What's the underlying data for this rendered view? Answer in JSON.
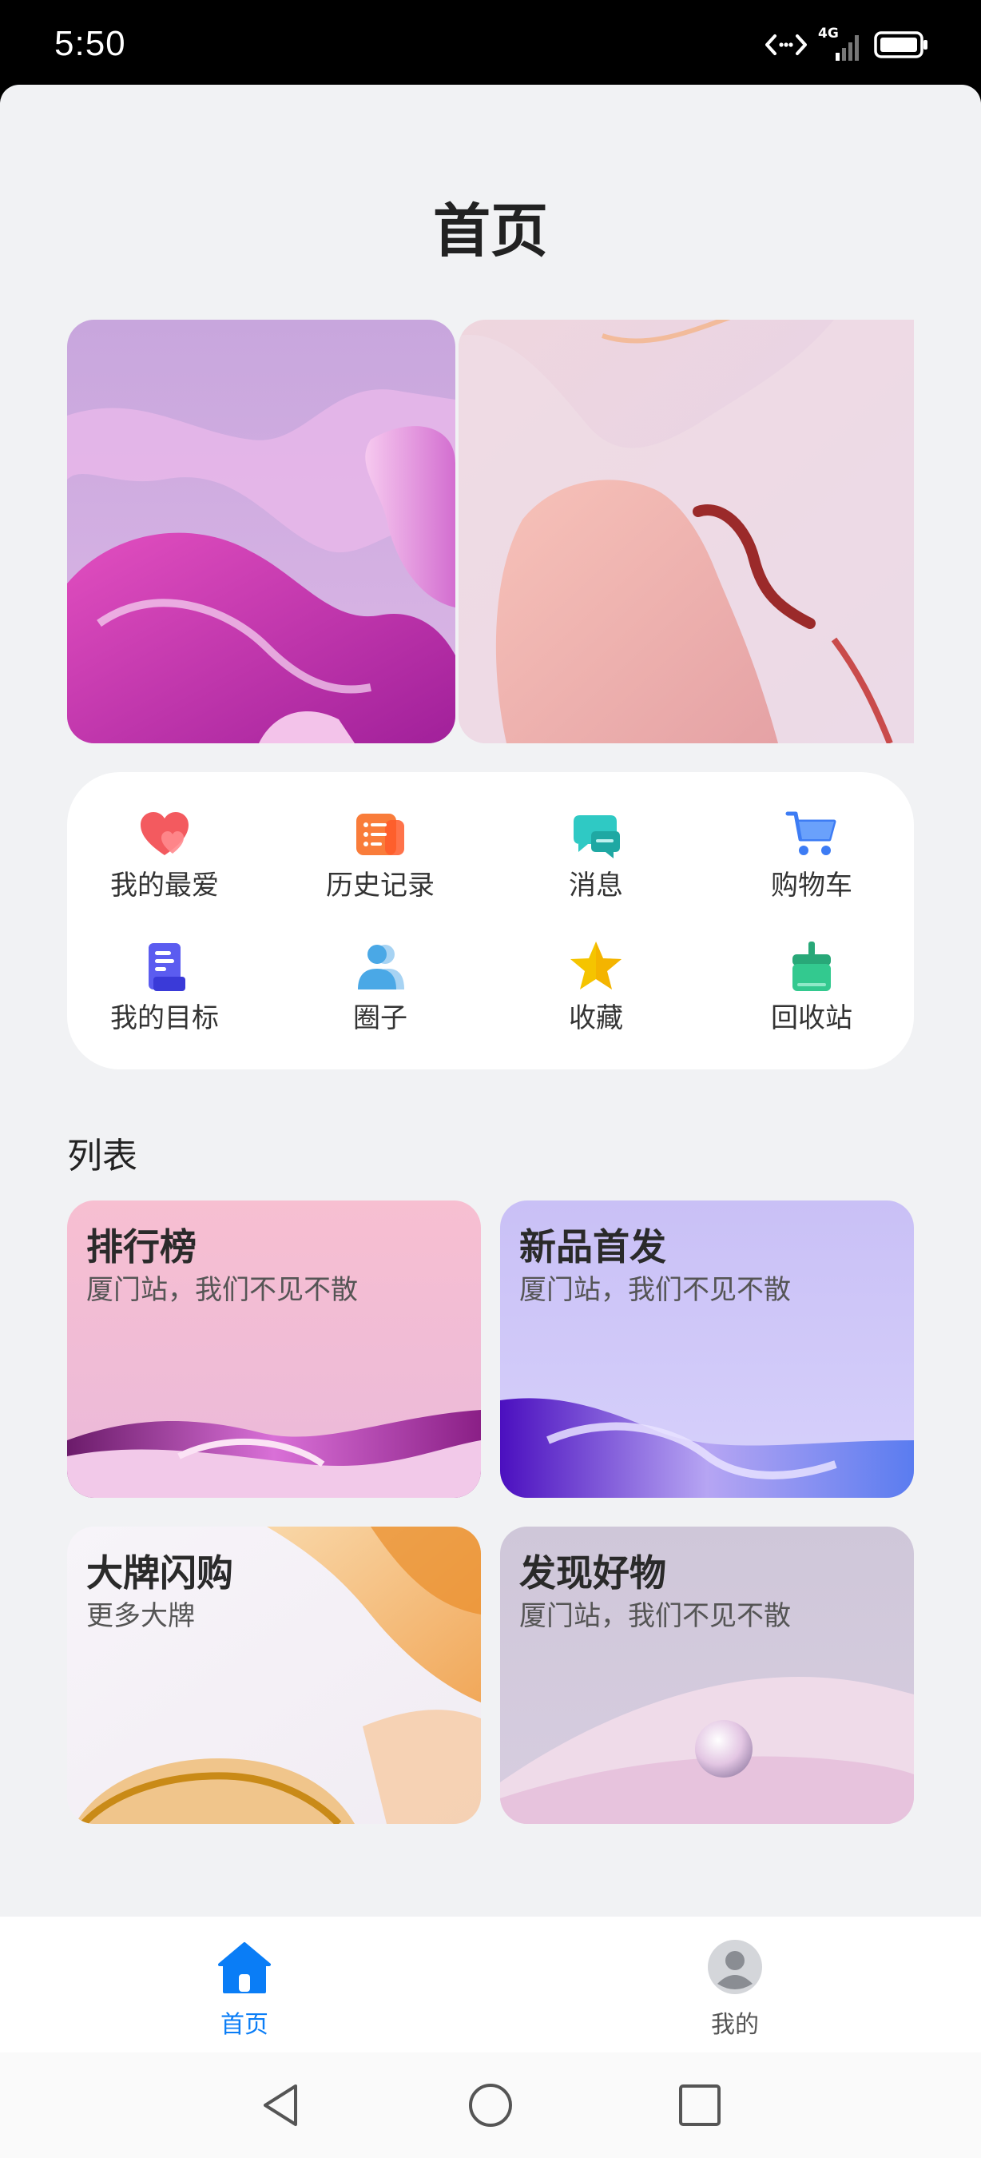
{
  "status_bar": {
    "time": "5:50",
    "network": "4G"
  },
  "page": {
    "title": "首页"
  },
  "banner": {
    "active_index": 1,
    "slide_count": 3
  },
  "quick_menu": [
    {
      "label": "我的最爱",
      "icon": "heart-icon",
      "color": "#f35a5f"
    },
    {
      "label": "历史记录",
      "icon": "history-icon",
      "color": "#f97c3a"
    },
    {
      "label": "消息",
      "icon": "message-icon",
      "color": "#2fc9c4"
    },
    {
      "label": "购物车",
      "icon": "cart-icon",
      "color": "#3d7cf4"
    },
    {
      "label": "我的目标",
      "icon": "goal-icon",
      "color": "#5b5cf0"
    },
    {
      "label": "圈子",
      "icon": "group-icon",
      "color": "#4aa8e6"
    },
    {
      "label": "收藏",
      "icon": "star-icon",
      "color": "#f5c400"
    },
    {
      "label": "回收站",
      "icon": "recycle-bin-icon",
      "color": "#33c98f"
    }
  ],
  "section": {
    "title": "列表"
  },
  "cards": [
    {
      "title": "排行榜",
      "subtitle": "厦门站，我们不见不散"
    },
    {
      "title": "新品首发",
      "subtitle": "厦门站，我们不见不散"
    },
    {
      "title": "大牌闪购",
      "subtitle": "更多大牌"
    },
    {
      "title": "发现好物",
      "subtitle": "厦门站，我们不见不散"
    }
  ],
  "tabbar": {
    "home": {
      "label": "首页",
      "active_color": "#0a7df6"
    },
    "mine": {
      "label": "我的",
      "color": "#555555"
    }
  }
}
